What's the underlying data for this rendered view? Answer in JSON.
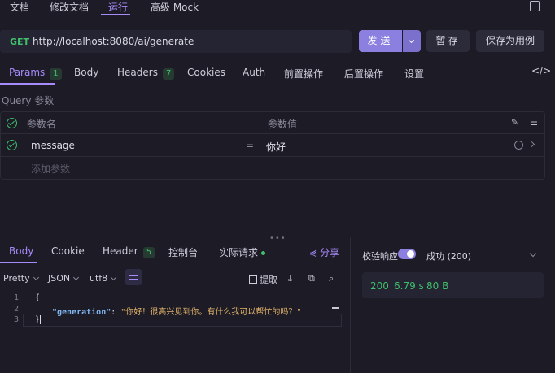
{
  "top_tabs": [
    {
      "label": "文档"
    },
    {
      "label": "修改文档"
    },
    {
      "label": "运行"
    },
    {
      "label": "高级 Mock"
    }
  ],
  "request": {
    "method": "GET",
    "url": "http://localhost:8080/ai/generate",
    "send_label": "发送",
    "save_label": "暂存",
    "save_case_label": "保存为用例"
  },
  "param_tabs": [
    {
      "label": "Params",
      "badge": "1"
    },
    {
      "label": "Body"
    },
    {
      "label": "Headers",
      "badge": "7"
    },
    {
      "label": "Cookies"
    },
    {
      "label": "Auth"
    },
    {
      "label": "前置操作"
    },
    {
      "label": "后置操作"
    },
    {
      "label": "设置"
    }
  ],
  "query": {
    "title": "Query 参数",
    "col_name": "参数名",
    "col_value": "参数值",
    "rows": [
      {
        "name": "message",
        "eq": "=",
        "value": "你好"
      }
    ],
    "add_placeholder": "添加参数"
  },
  "response_tabs": [
    {
      "label": "Body"
    },
    {
      "label": "Cookie"
    },
    {
      "label": "Header",
      "badge": "5"
    },
    {
      "label": "控制台"
    },
    {
      "label": "实际请求"
    }
  ],
  "share_label": "分享",
  "toolbar": {
    "format": "Pretty",
    "type": "JSON",
    "encoding": "utf8",
    "extract_label": "提取"
  },
  "editor": {
    "line_numbers": [
      "1",
      "2",
      "3"
    ],
    "open_brace": "{",
    "key": "\"generation\"",
    "colon": ": ",
    "value": "\"你好！很高兴见到你。有什么我可以帮忙的吗？\"",
    "close_brace": "}"
  },
  "right_panel": {
    "validate_label": "校验响应",
    "validate_on": true,
    "status_label": "成功 (200)",
    "status_code": "200",
    "time": "6.79 s",
    "size": "80 B"
  },
  "colors": {
    "accent": "#a78bfa",
    "success": "#3fbf6b",
    "background": "#1c1b26"
  }
}
